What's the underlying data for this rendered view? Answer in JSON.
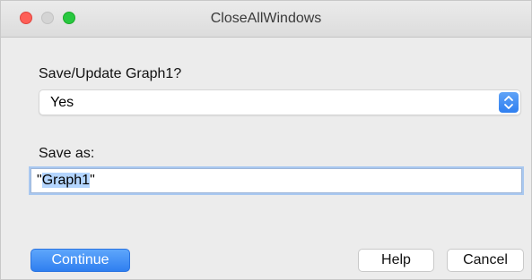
{
  "window": {
    "title": "CloseAllWindows"
  },
  "prompt": {
    "label": "Save/Update Graph1?",
    "selected_value": "Yes"
  },
  "save_as": {
    "label": "Save as:",
    "value_open_quote": "\"",
    "value_selected": "Graph1",
    "value_close_quote": "\""
  },
  "buttons": {
    "continue": "Continue",
    "help": "Help",
    "cancel": "Cancel"
  },
  "icons": {
    "select_stepper": "chevron-up-down-icon"
  },
  "colors": {
    "accent": "#2f7ff0",
    "close": "#fe5f57",
    "zoom": "#28c840",
    "selection": "#b4d5fe"
  }
}
